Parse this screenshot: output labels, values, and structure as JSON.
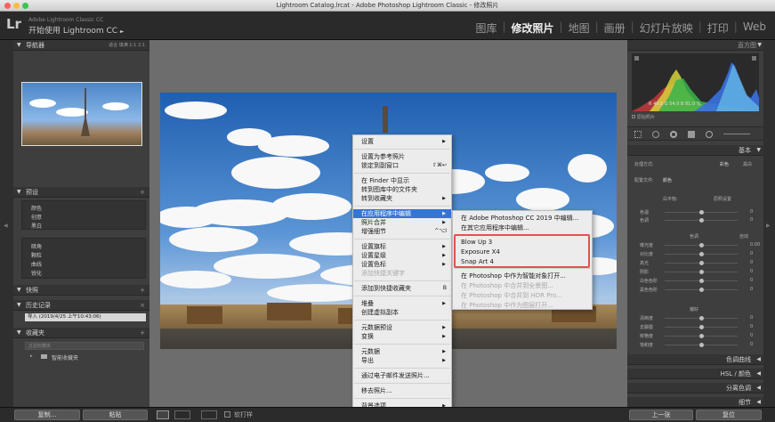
{
  "window": {
    "title": "Lightroom Catalog.lrcat - Adobe Photoshop Lightroom Classic - 修改照片"
  },
  "identity": {
    "logo": "Lr",
    "app_name": "Adobe Lightroom Classic CC",
    "subtitle": "开始使用 Lightroom CC",
    "subtitle_arrow": "►"
  },
  "modules": [
    {
      "label": "图库",
      "active": false
    },
    {
      "label": "修改照片",
      "active": true
    },
    {
      "label": "地图",
      "active": false
    },
    {
      "label": "画册",
      "active": false
    },
    {
      "label": "幻灯片放映",
      "active": false
    },
    {
      "label": "打印",
      "active": false
    },
    {
      "label": "Web",
      "active": false
    }
  ],
  "left_panel": {
    "navigator": {
      "title": "导航器",
      "opts": "适合  填满  1:1  2:1"
    },
    "presets": {
      "title": "预设",
      "items_a": [
        "颜色",
        "创意",
        "黑白"
      ],
      "items_b": [
        "暗角",
        "颗粒",
        "曲线",
        "锐化"
      ]
    },
    "snapshots": {
      "title": "快照"
    },
    "history": {
      "title": "历史记录",
      "entry": "导入 (2019/4/25 上午10:43:06)"
    },
    "collections": {
      "title": "收藏夹",
      "filter_placeholder": "过滤收藏夹",
      "smart": "智能收藏夹"
    },
    "copy_button": "复制...",
    "paste_button": "粘贴"
  },
  "right_panel": {
    "histogram": {
      "title": "直方图",
      "readout": "R  49.8  G  54.0  B  81.0 %",
      "original": "原始照片"
    },
    "basic": {
      "title": "基本",
      "treatment_label": "处理方式:",
      "treatment_color": "彩色",
      "treatment_bw": "黑白",
      "profile_label": "配置文件:",
      "profile_value": "颜色",
      "wb_label": "白平衡:",
      "wb_value": "原照设置",
      "tone_label": "色调",
      "auto_label": "自动",
      "presence_label": "偏好",
      "sliders_wb": [
        {
          "label": "色温",
          "value": "0"
        },
        {
          "label": "色调",
          "value": "0"
        }
      ],
      "sliders_tone": [
        {
          "label": "曝光度",
          "value": "0.00"
        },
        {
          "label": "对比度",
          "value": "0"
        },
        {
          "label": "高光",
          "value": "0"
        },
        {
          "label": "阴影",
          "value": "0"
        },
        {
          "label": "白色色阶",
          "value": "0"
        },
        {
          "label": "黑色色阶",
          "value": "0"
        }
      ],
      "sliders_presence": [
        {
          "label": "清晰度",
          "value": "0"
        },
        {
          "label": "去朦胧",
          "value": "0"
        },
        {
          "label": "鲜艳度",
          "value": "0"
        },
        {
          "label": "饱和度",
          "value": "0"
        }
      ]
    },
    "sections": [
      "色调曲线",
      "HSL / 颜色",
      "分离色调",
      "细节"
    ],
    "prev_button": "上一张",
    "reset_button": "复位"
  },
  "toolbar": {
    "soft_proof": "软打样"
  },
  "context_menu": {
    "items": [
      {
        "label": "设置",
        "submenu": true
      },
      {
        "label": "设置为参考照片"
      },
      {
        "label": "锁定到副窗口",
        "shortcut": "⇧⌘↩"
      },
      {
        "label": "在 Finder 中显示"
      },
      {
        "label": "转到图库中的文件夹"
      },
      {
        "label": "转到收藏夹",
        "submenu": true
      },
      {
        "label": "在应用程序中编辑",
        "submenu": true,
        "highlighted": true
      },
      {
        "label": "照片合并",
        "submenu": true
      },
      {
        "label": "增强细节",
        "shortcut": "^⌥I"
      },
      {
        "label": "设置旗标",
        "submenu": true
      },
      {
        "label": "设置星级",
        "submenu": true
      },
      {
        "label": "设置色标",
        "submenu": true
      },
      {
        "label": "添加快捷关键字",
        "disabled": true
      },
      {
        "label": "添加到快捷收藏夹",
        "shortcut": "B"
      },
      {
        "label": "堆叠",
        "submenu": true
      },
      {
        "label": "创建虚拟副本"
      },
      {
        "label": "元数据预设",
        "submenu": true
      },
      {
        "label": "变换",
        "submenu": true
      },
      {
        "label": "元数据",
        "submenu": true
      },
      {
        "label": "导出",
        "submenu": true
      },
      {
        "label": "通过电子邮件发送照片..."
      },
      {
        "label": "移去照片..."
      },
      {
        "label": "背景选项",
        "submenu": true
      }
    ]
  },
  "edit_submenu": {
    "items": [
      {
        "label": "在 Adobe Photoshop CC 2019 中编辑..."
      },
      {
        "label": "在其它应用程序中编辑..."
      },
      {
        "label": "Blow Up 3"
      },
      {
        "label": "Exposure X4"
      },
      {
        "label": "Snap Art 4"
      },
      {
        "label": "在 Photoshop 中作为智能对象打开..."
      },
      {
        "label": "在 Photoshop 中合并到全景图...",
        "disabled": true
      },
      {
        "label": "在 Photoshop 中合并到 HDR Pro...",
        "disabled": true
      },
      {
        "label": "在 Photoshop 中作为图层打开...",
        "disabled": true
      }
    ]
  },
  "colors": {
    "highlight": "#3476d6",
    "annotation": "#e0534d",
    "panel": "#3e3e3e"
  }
}
